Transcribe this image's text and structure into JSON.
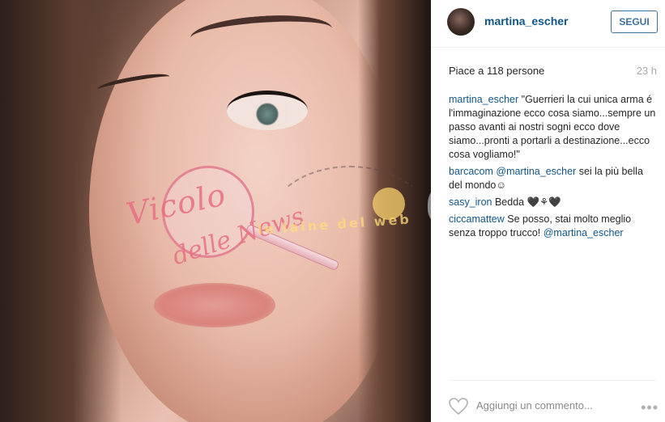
{
  "post": {
    "username": "martina_escher",
    "follow_label": "SEGUI",
    "likes_text": "Piace a 118 persone",
    "time_ago": "23 h"
  },
  "comments": [
    {
      "user": "martina_escher",
      "text": " \"Guerrieri la cui unica arma é l'immaginazione ecco cosa siamo...sempre un passo avanti ai nostri sogni ecco dove siamo...pronti a portarli a destinazione...ecco cosa vogliamo!\""
    },
    {
      "user": "barcacom",
      "mention": "@martina_escher",
      "text": " sei la più bella del mondo☺"
    },
    {
      "user": "sasy_iron",
      "text": " Bedda 🖤⚘🖤"
    },
    {
      "user": "ciccamattew",
      "text": " Se posso, stai molto meglio senza troppo trucco! ",
      "mention": "@martina_escher"
    }
  ],
  "footer": {
    "add_comment_placeholder": "Aggiungi un commento...",
    "more_label": "•••"
  },
  "watermark": {
    "line1": "Vicolo",
    "line2": "delle News",
    "banner": "le laine del web"
  },
  "colors": {
    "link_blue": "#125688",
    "follow_border": "#3f729b",
    "muted": "#a5a7aa"
  },
  "icons": [
    "heart-icon",
    "more-options-icon"
  ]
}
